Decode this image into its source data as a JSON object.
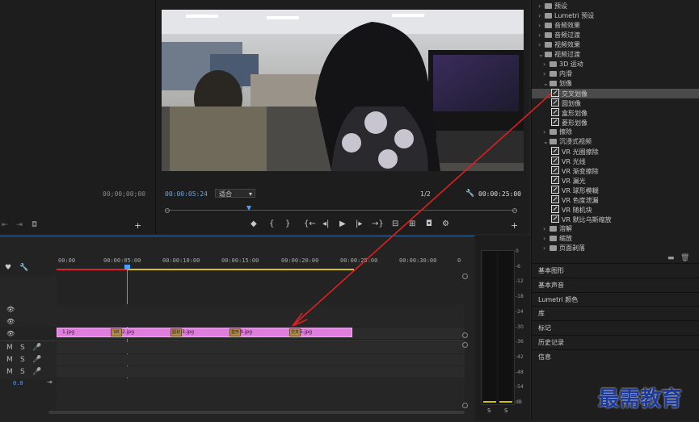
{
  "source_panel": {
    "timecode": "00;00;00;00"
  },
  "program_monitor": {
    "current_time": "00:00:05:24",
    "fit_select": "适合",
    "resolution": "1/2",
    "duration": "00:00:25:00",
    "transport_buttons": [
      "标记入点",
      "标记出点入",
      "标记出点",
      "转到入点",
      "后退一帧",
      "播放",
      "前进一帧",
      "转到出点",
      "提升",
      "提取",
      "导出帧",
      "按钮编辑器"
    ]
  },
  "effects_tree": [
    {
      "label": "预设",
      "level": 0,
      "type": "folder"
    },
    {
      "label": "Lumetri 预设",
      "level": 0,
      "type": "folder"
    },
    {
      "label": "音频效果",
      "level": 0,
      "type": "folder"
    },
    {
      "label": "音频过渡",
      "level": 0,
      "type": "folder"
    },
    {
      "label": "视频效果",
      "level": 0,
      "type": "folder"
    },
    {
      "label": "视频过渡",
      "level": 0,
      "type": "folder",
      "open": true
    },
    {
      "label": "3D 运动",
      "level": 1,
      "type": "folder"
    },
    {
      "label": "内滑",
      "level": 1,
      "type": "folder"
    },
    {
      "label": "划像",
      "level": 1,
      "type": "folder",
      "open": true
    },
    {
      "label": "交叉划像",
      "level": 2,
      "type": "effect",
      "selected": true
    },
    {
      "label": "圆划像",
      "level": 2,
      "type": "effect"
    },
    {
      "label": "盒形划像",
      "level": 2,
      "type": "effect"
    },
    {
      "label": "菱形划像",
      "level": 2,
      "type": "effect"
    },
    {
      "label": "擦除",
      "level": 1,
      "type": "folder"
    },
    {
      "label": "沉浸式视频",
      "level": 1,
      "type": "folder",
      "open": true
    },
    {
      "label": "VR 光圈擦除",
      "level": 2,
      "type": "effect"
    },
    {
      "label": "VR 光线",
      "level": 2,
      "type": "effect"
    },
    {
      "label": "VR 渐变擦除",
      "level": 2,
      "type": "effect"
    },
    {
      "label": "VR 漏光",
      "level": 2,
      "type": "effect"
    },
    {
      "label": "VR 球形模糊",
      "level": 2,
      "type": "effect"
    },
    {
      "label": "VR 色度泄漏",
      "level": 2,
      "type": "effect"
    },
    {
      "label": "VR 随机块",
      "level": 2,
      "type": "effect"
    },
    {
      "label": "VR 默比乌斯缩放",
      "level": 2,
      "type": "effect"
    },
    {
      "label": "溶解",
      "level": 1,
      "type": "folder"
    },
    {
      "label": "缩放",
      "level": 1,
      "type": "folder"
    },
    {
      "label": "页面剥落",
      "level": 1,
      "type": "folder"
    }
  ],
  "side_panels": [
    "基本图形",
    "基本声音",
    "Lumetri 颜色",
    "库",
    "标记",
    "历史记录",
    "信息"
  ],
  "timeline": {
    "ruler": [
      "00:00",
      "00:00:05:00",
      "00:00:10:00",
      "00:00:15:00",
      "00:00:20:00",
      "00:00:25:00",
      "00:00:30:00",
      "0"
    ],
    "clips": [
      "1.jpg",
      "2.jpg",
      "3.jpg",
      "4.jpg",
      "5.jpg"
    ],
    "transitions": [
      "VR",
      "圆划",
      "盒形",
      "交叉"
    ],
    "track_controls": {
      "mute": "M",
      "solo": "S"
    },
    "level": "0.0"
  },
  "audio_meter": {
    "scale": [
      "0",
      "-6",
      "-12",
      "-18",
      "-24",
      "-30",
      "-36",
      "-42",
      "-48",
      "-54",
      "dB"
    ],
    "solo_buttons": [
      "S",
      "S"
    ]
  },
  "watermark": "最需教育"
}
